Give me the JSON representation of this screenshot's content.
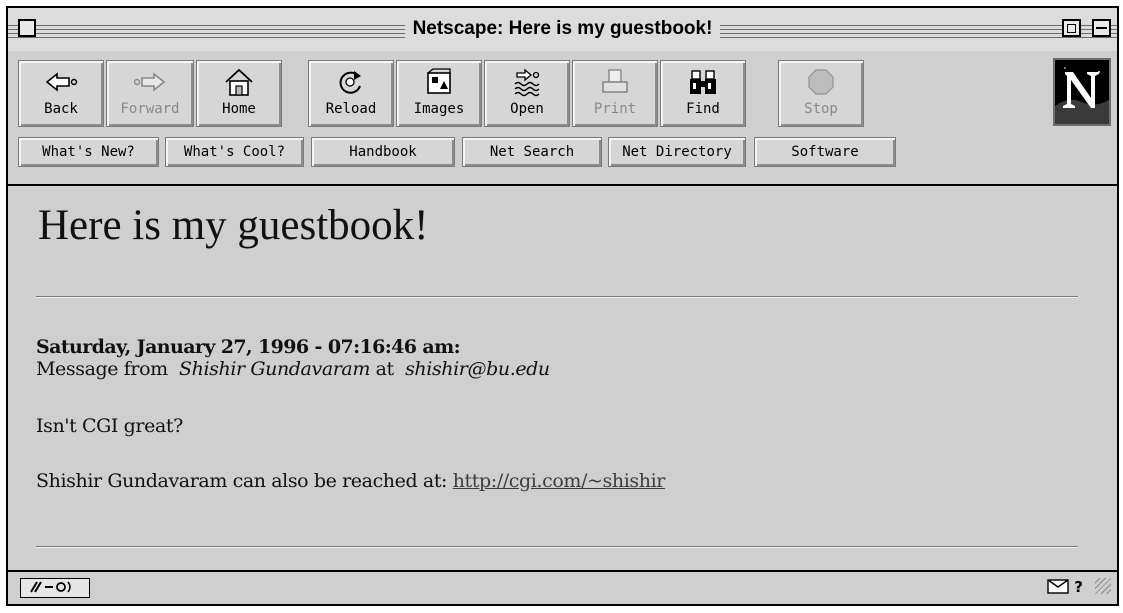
{
  "window": {
    "title": "Netscape: Here is my guestbook!"
  },
  "toolbar": {
    "buttons": [
      {
        "label": "Back",
        "icon": "back-arrow-icon",
        "enabled": true
      },
      {
        "label": "Forward",
        "icon": "forward-arrow-icon",
        "enabled": false
      },
      {
        "label": "Home",
        "icon": "home-icon",
        "enabled": true
      },
      {
        "label": "Reload",
        "icon": "reload-icon",
        "enabled": true
      },
      {
        "label": "Images",
        "icon": "images-icon",
        "enabled": true
      },
      {
        "label": "Open",
        "icon": "open-icon",
        "enabled": true
      },
      {
        "label": "Print",
        "icon": "printer-icon",
        "enabled": false
      },
      {
        "label": "Find",
        "icon": "binoculars-icon",
        "enabled": true
      },
      {
        "label": "Stop",
        "icon": "stop-icon",
        "enabled": false
      }
    ],
    "directory_buttons": [
      "What's New?",
      "What's Cool?",
      "Handbook",
      "Net Search",
      "Net Directory",
      "Software"
    ]
  },
  "page": {
    "heading": "Here is my guestbook!",
    "entries": [
      {
        "date": "Saturday, January 27, 1996 - 07:16:46 am:",
        "message_prefix": "Message from",
        "name": "Shishir Gundavaram",
        "at": "at",
        "email": "shishir@bu.edu",
        "message": "Isn't CGI great?",
        "reach_text": "Shishir Gundavaram can also be reached at:",
        "url": "http://cgi.com/~shishir"
      }
    ]
  },
  "statusbar": {
    "security_icon": "broken-key-icon",
    "mail_icon": "mail-icon",
    "help_glyph": "?"
  },
  "colors": {
    "chrome": "#cfcfcf",
    "border": "#000000",
    "link": "#3d3d3d"
  }
}
